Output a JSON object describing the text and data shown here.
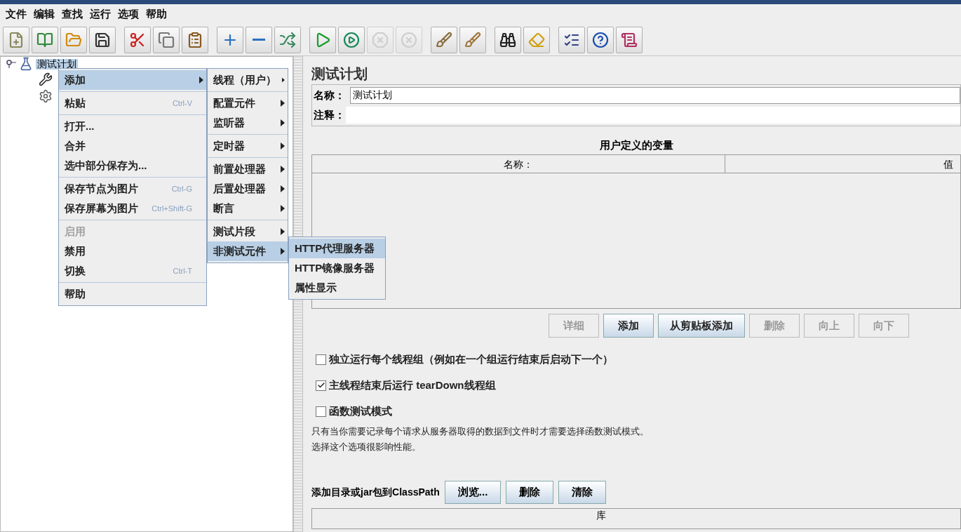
{
  "menu_bar": [
    "文件",
    "编辑",
    "查找",
    "运行",
    "选项",
    "帮助"
  ],
  "toolbar": [
    [
      {
        "kind": "new",
        "disabled": false
      },
      {
        "kind": "templates",
        "disabled": false
      },
      {
        "kind": "open",
        "disabled": false
      },
      {
        "kind": "save",
        "disabled": false
      }
    ],
    [
      {
        "kind": "cut",
        "disabled": false
      },
      {
        "kind": "copy",
        "disabled": false
      },
      {
        "kind": "paste",
        "disabled": false
      }
    ],
    [
      {
        "kind": "expand",
        "disabled": false
      },
      {
        "kind": "collapse",
        "disabled": false
      },
      {
        "kind": "toggle",
        "disabled": false
      }
    ],
    [
      {
        "kind": "start",
        "disabled": false
      },
      {
        "kind": "start-no-pause",
        "disabled": false
      },
      {
        "kind": "stop",
        "disabled": true
      },
      {
        "kind": "shutdown",
        "disabled": true
      }
    ],
    [
      {
        "kind": "clear",
        "disabled": false
      },
      {
        "kind": "clear-all",
        "disabled": false
      }
    ],
    [
      {
        "kind": "search",
        "disabled": false
      },
      {
        "kind": "reset-search",
        "disabled": false
      }
    ],
    [
      {
        "kind": "functions",
        "disabled": false
      },
      {
        "kind": "help",
        "disabled": false
      },
      {
        "kind": "log",
        "disabled": false
      }
    ]
  ],
  "tree": {
    "root": {
      "label": "测试计划",
      "selected": true
    },
    "children": [
      {
        "kind": "tools"
      },
      {
        "kind": "gear"
      }
    ]
  },
  "context_menu": [
    [
      {
        "label": "添加",
        "selected": true,
        "submenu": true,
        "disabled": false
      }
    ],
    [
      {
        "label": "粘贴",
        "shortcut": "Ctrl-V",
        "selected": false,
        "submenu": false,
        "disabled": false
      }
    ],
    [
      {
        "label": "打开...",
        "selected": false,
        "submenu": false,
        "disabled": false
      },
      {
        "label": "合并",
        "selected": false,
        "submenu": false,
        "disabled": false
      },
      {
        "label": "选中部分保存为...",
        "selected": false,
        "submenu": false,
        "disabled": false
      }
    ],
    [
      {
        "label": "保存节点为图片",
        "shortcut": "Ctrl-G",
        "selected": false,
        "submenu": false,
        "disabled": false
      },
      {
        "label": "保存屏幕为图片",
        "shortcut": "Ctrl+Shift-G",
        "selected": false,
        "submenu": false,
        "disabled": false
      }
    ],
    [
      {
        "label": "启用",
        "selected": false,
        "submenu": false,
        "disabled": true
      },
      {
        "label": "禁用",
        "selected": false,
        "submenu": false,
        "disabled": false
      },
      {
        "label": "切换",
        "shortcut": "Ctrl-T",
        "selected": false,
        "submenu": false,
        "disabled": false
      }
    ],
    [
      {
        "label": "帮助",
        "selected": false,
        "submenu": false,
        "disabled": false
      }
    ]
  ],
  "add_submenu": [
    [
      {
        "label": "线程（用户）",
        "selected": false,
        "submenu": true
      }
    ],
    [
      {
        "label": "配置元件",
        "selected": false,
        "submenu": true
      },
      {
        "label": "监听器",
        "selected": false,
        "submenu": true
      }
    ],
    [
      {
        "label": "定时器",
        "selected": false,
        "submenu": true
      }
    ],
    [
      {
        "label": "前置处理器",
        "selected": false,
        "submenu": true
      },
      {
        "label": "后置处理器",
        "selected": false,
        "submenu": true
      },
      {
        "label": "断言",
        "selected": false,
        "submenu": true
      }
    ],
    [
      {
        "label": "测试片段",
        "selected": false,
        "submenu": true
      },
      {
        "label": "非测试元件",
        "selected": true,
        "submenu": true
      }
    ]
  ],
  "non_test_submenu": [
    {
      "label": "HTTP代理服务器",
      "selected": true
    },
    {
      "label": "HTTP镜像服务器",
      "selected": false
    },
    {
      "label": "属性显示",
      "selected": false
    }
  ],
  "panel": {
    "title": "测试计划",
    "name_label": "名称：",
    "name_value": "测试计划",
    "comment_label": "注释：",
    "variables_title": "用户定义的变量",
    "columns": [
      "名称：",
      "值"
    ],
    "buttons": [
      {
        "label": "详细",
        "disabled": true
      },
      {
        "label": "添加",
        "disabled": false
      },
      {
        "label": "从剪贴板添加",
        "disabled": false
      },
      {
        "label": "删除",
        "disabled": true
      },
      {
        "label": "向上",
        "disabled": true
      },
      {
        "label": "向下",
        "disabled": true
      }
    ],
    "options": [
      {
        "label": "独立运行每个线程组（例如在一个组运行结束后启动下一个）",
        "checked": false
      },
      {
        "label": "主线程结束后运行 tearDown线程组",
        "checked": true
      },
      {
        "label": "函数测试模式",
        "checked": false
      }
    ],
    "note": [
      "只有当你需要记录每个请求从服务器取得的数据到文件时才需要选择函数测试模式。",
      "选择这个选项很影响性能。"
    ],
    "classpath_label": "添加目录或jar包到ClassPath",
    "classpath_buttons": [
      "浏览...",
      "删除",
      "清除"
    ],
    "library_column": "库"
  }
}
